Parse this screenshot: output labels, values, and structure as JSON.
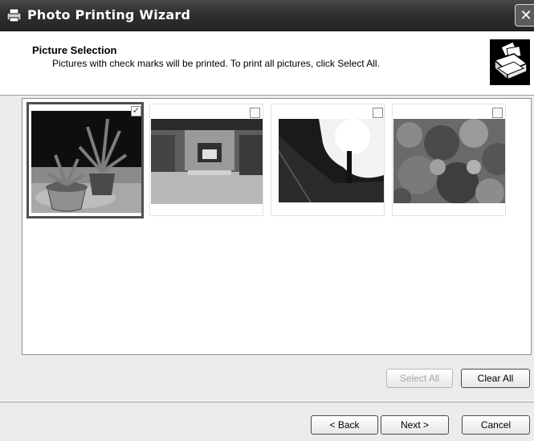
{
  "window": {
    "title": "Photo Printing Wizard",
    "close_glyph": "✕"
  },
  "header": {
    "title": "Picture Selection",
    "subtitle": "Pictures with check marks will be printed.  To print all pictures, click Select All.",
    "icon": "printer-photo-icon"
  },
  "pictures": [
    {
      "description": "potted plant on windowsill",
      "checked": true
    },
    {
      "description": "room with fireplace",
      "checked": false
    },
    {
      "description": "bright window scene",
      "checked": false
    },
    {
      "description": "garden foliage",
      "checked": false
    }
  ],
  "buttons": {
    "select_all": "Select All",
    "clear_all": "Clear All",
    "back": "< Back",
    "next": "Next >",
    "cancel": "Cancel"
  },
  "check_glyph": "✓"
}
